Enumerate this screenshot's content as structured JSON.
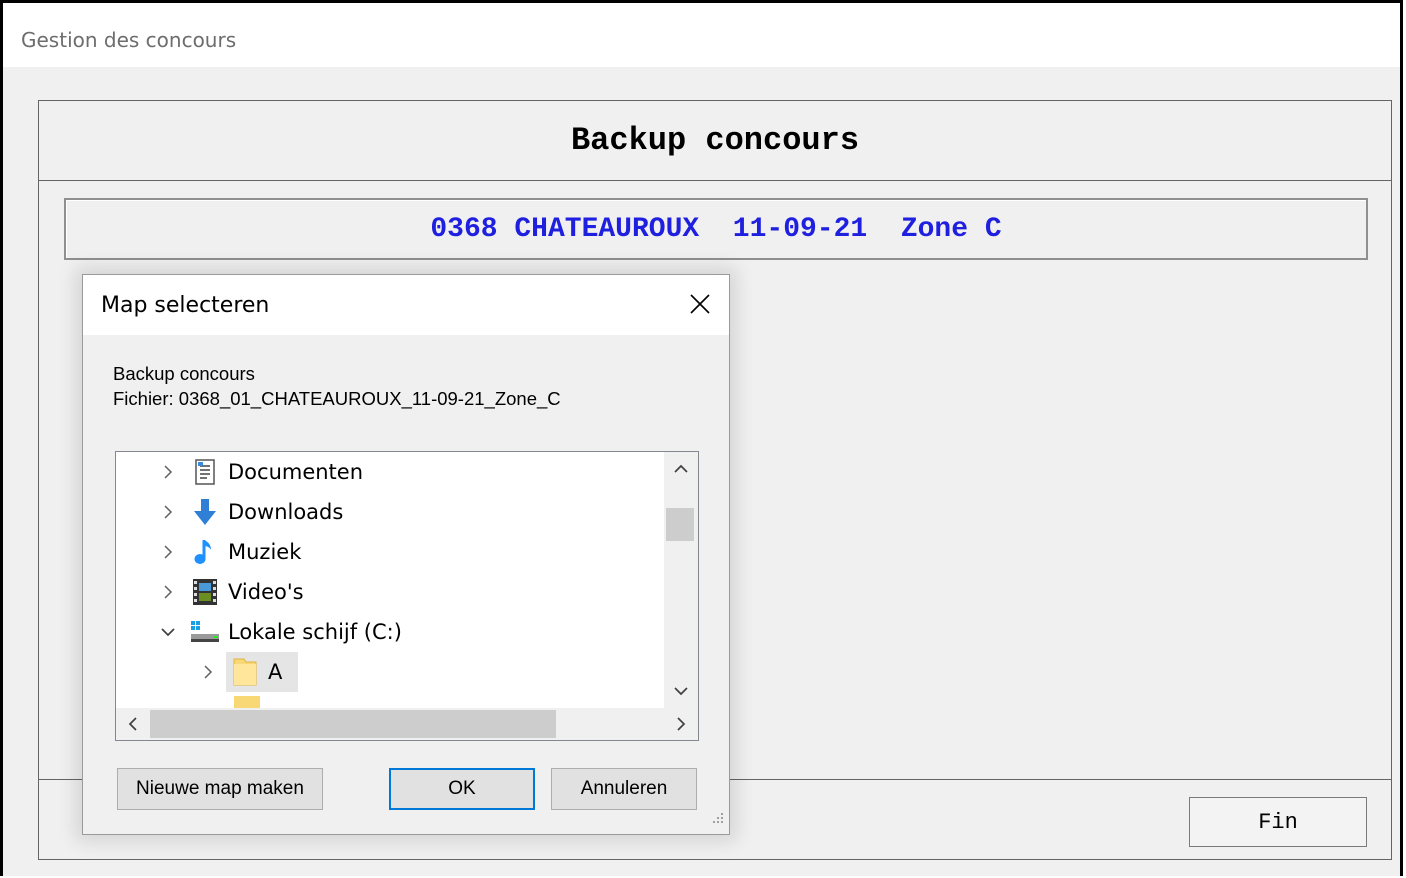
{
  "app": {
    "title": "Gestion des concours"
  },
  "panel": {
    "title": "Backup concours",
    "info": "0368 CHATEAUROUX  11-09-21  Zone C",
    "fin_label": "Fin"
  },
  "dialog": {
    "title": "Map selecteren",
    "desc_line1": "Backup concours",
    "desc_line2": "Fichier: 0368_01_CHATEAUROUX_11-09-21_Zone_C",
    "tree": [
      {
        "label": "Documenten",
        "icon": "documents-icon",
        "expanded": false
      },
      {
        "label": "Downloads",
        "icon": "downloads-icon",
        "expanded": false
      },
      {
        "label": "Muziek",
        "icon": "music-icon",
        "expanded": false
      },
      {
        "label": "Video's",
        "icon": "videos-icon",
        "expanded": false
      },
      {
        "label": "Lokale schijf (C:)",
        "icon": "drive-icon",
        "expanded": true
      },
      {
        "label": "A",
        "icon": "folder-icon",
        "expanded": false,
        "selected": true
      }
    ],
    "buttons": {
      "new_folder": "Nieuwe map maken",
      "ok": "OK",
      "cancel": "Annuleren"
    }
  },
  "colors": {
    "info_text": "#1f1fe0",
    "primary_border": "#0078d7"
  }
}
